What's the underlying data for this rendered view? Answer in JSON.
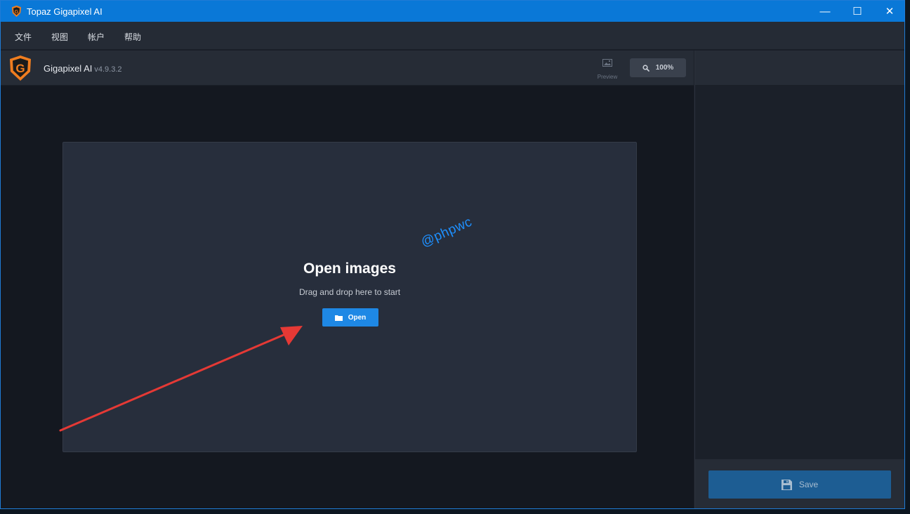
{
  "window": {
    "title": "Topaz Gigapixel AI",
    "minimize_glyph": "—",
    "maximize_glyph": "☐",
    "close_glyph": "✕"
  },
  "menu": {
    "items": [
      "文件",
      "视图",
      "帐户",
      "帮助"
    ]
  },
  "header": {
    "app_name": "Gigapixel AI",
    "version": "v4.9.3.2",
    "preview_label": "Preview",
    "zoom_label": "100%"
  },
  "dropzone": {
    "title": "Open images",
    "subtitle": "Drag and drop here to start",
    "open_label": "Open"
  },
  "watermark": "@phpwc",
  "footer": {
    "save_label": "Save"
  },
  "icons": {
    "app": "topaz-g-logo-icon",
    "preview": "image-icon",
    "zoom": "magnifier-icon",
    "open": "folder-icon",
    "save": "floppy-disk-icon"
  },
  "colors": {
    "titlebar": "#0a78d7",
    "accent": "#1e88e5",
    "save_button": "#1d5d93",
    "logo_orange": "#f07d1f",
    "arrow": "#e53935",
    "watermark": "#1e90ff"
  }
}
